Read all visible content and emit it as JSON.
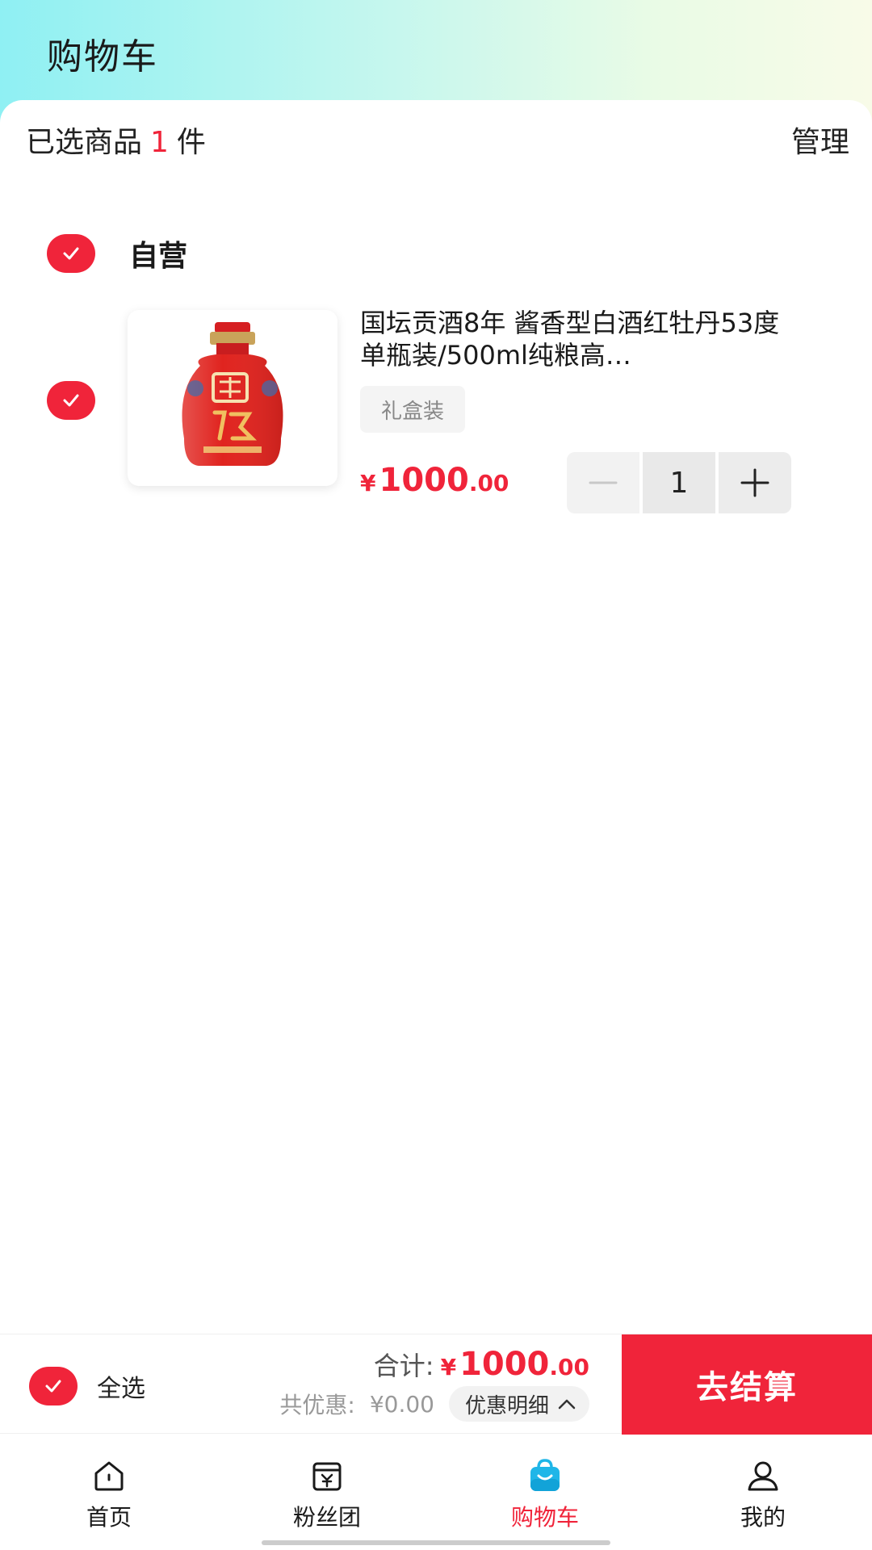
{
  "header": {
    "title": "购物车"
  },
  "summary": {
    "prefix": "已选商品",
    "count": "1",
    "suffix": "件",
    "manage_label": "管理"
  },
  "shop": {
    "name": "自营"
  },
  "item": {
    "title": "国坛贡酒8年 酱香型白酒红牡丹53度单瓶装/500ml纯粮高…",
    "spec": "礼盒装",
    "price": {
      "symbol": "¥",
      "integer": "1000",
      "decimal": ".00"
    },
    "quantity": "1"
  },
  "checkout": {
    "select_all_label": "全选",
    "total_label": "合计:",
    "total": {
      "symbol": "¥",
      "integer": "1000",
      "decimal": ".00"
    },
    "discount_label": "共优惠:",
    "discount_value": "¥0.00",
    "discount_detail_label": "优惠明细",
    "checkout_label": "去结算"
  },
  "tabbar": {
    "items": [
      {
        "label": "首页",
        "icon": "home-icon"
      },
      {
        "label": "粉丝团",
        "icon": "fan-group-icon"
      },
      {
        "label": "购物车",
        "icon": "shopping-bag-icon"
      },
      {
        "label": "我的",
        "icon": "user-icon"
      }
    ],
    "active_index": 2
  },
  "colors": {
    "accent": "#f0243a",
    "tab_icon_active": "#1fb6e8"
  }
}
